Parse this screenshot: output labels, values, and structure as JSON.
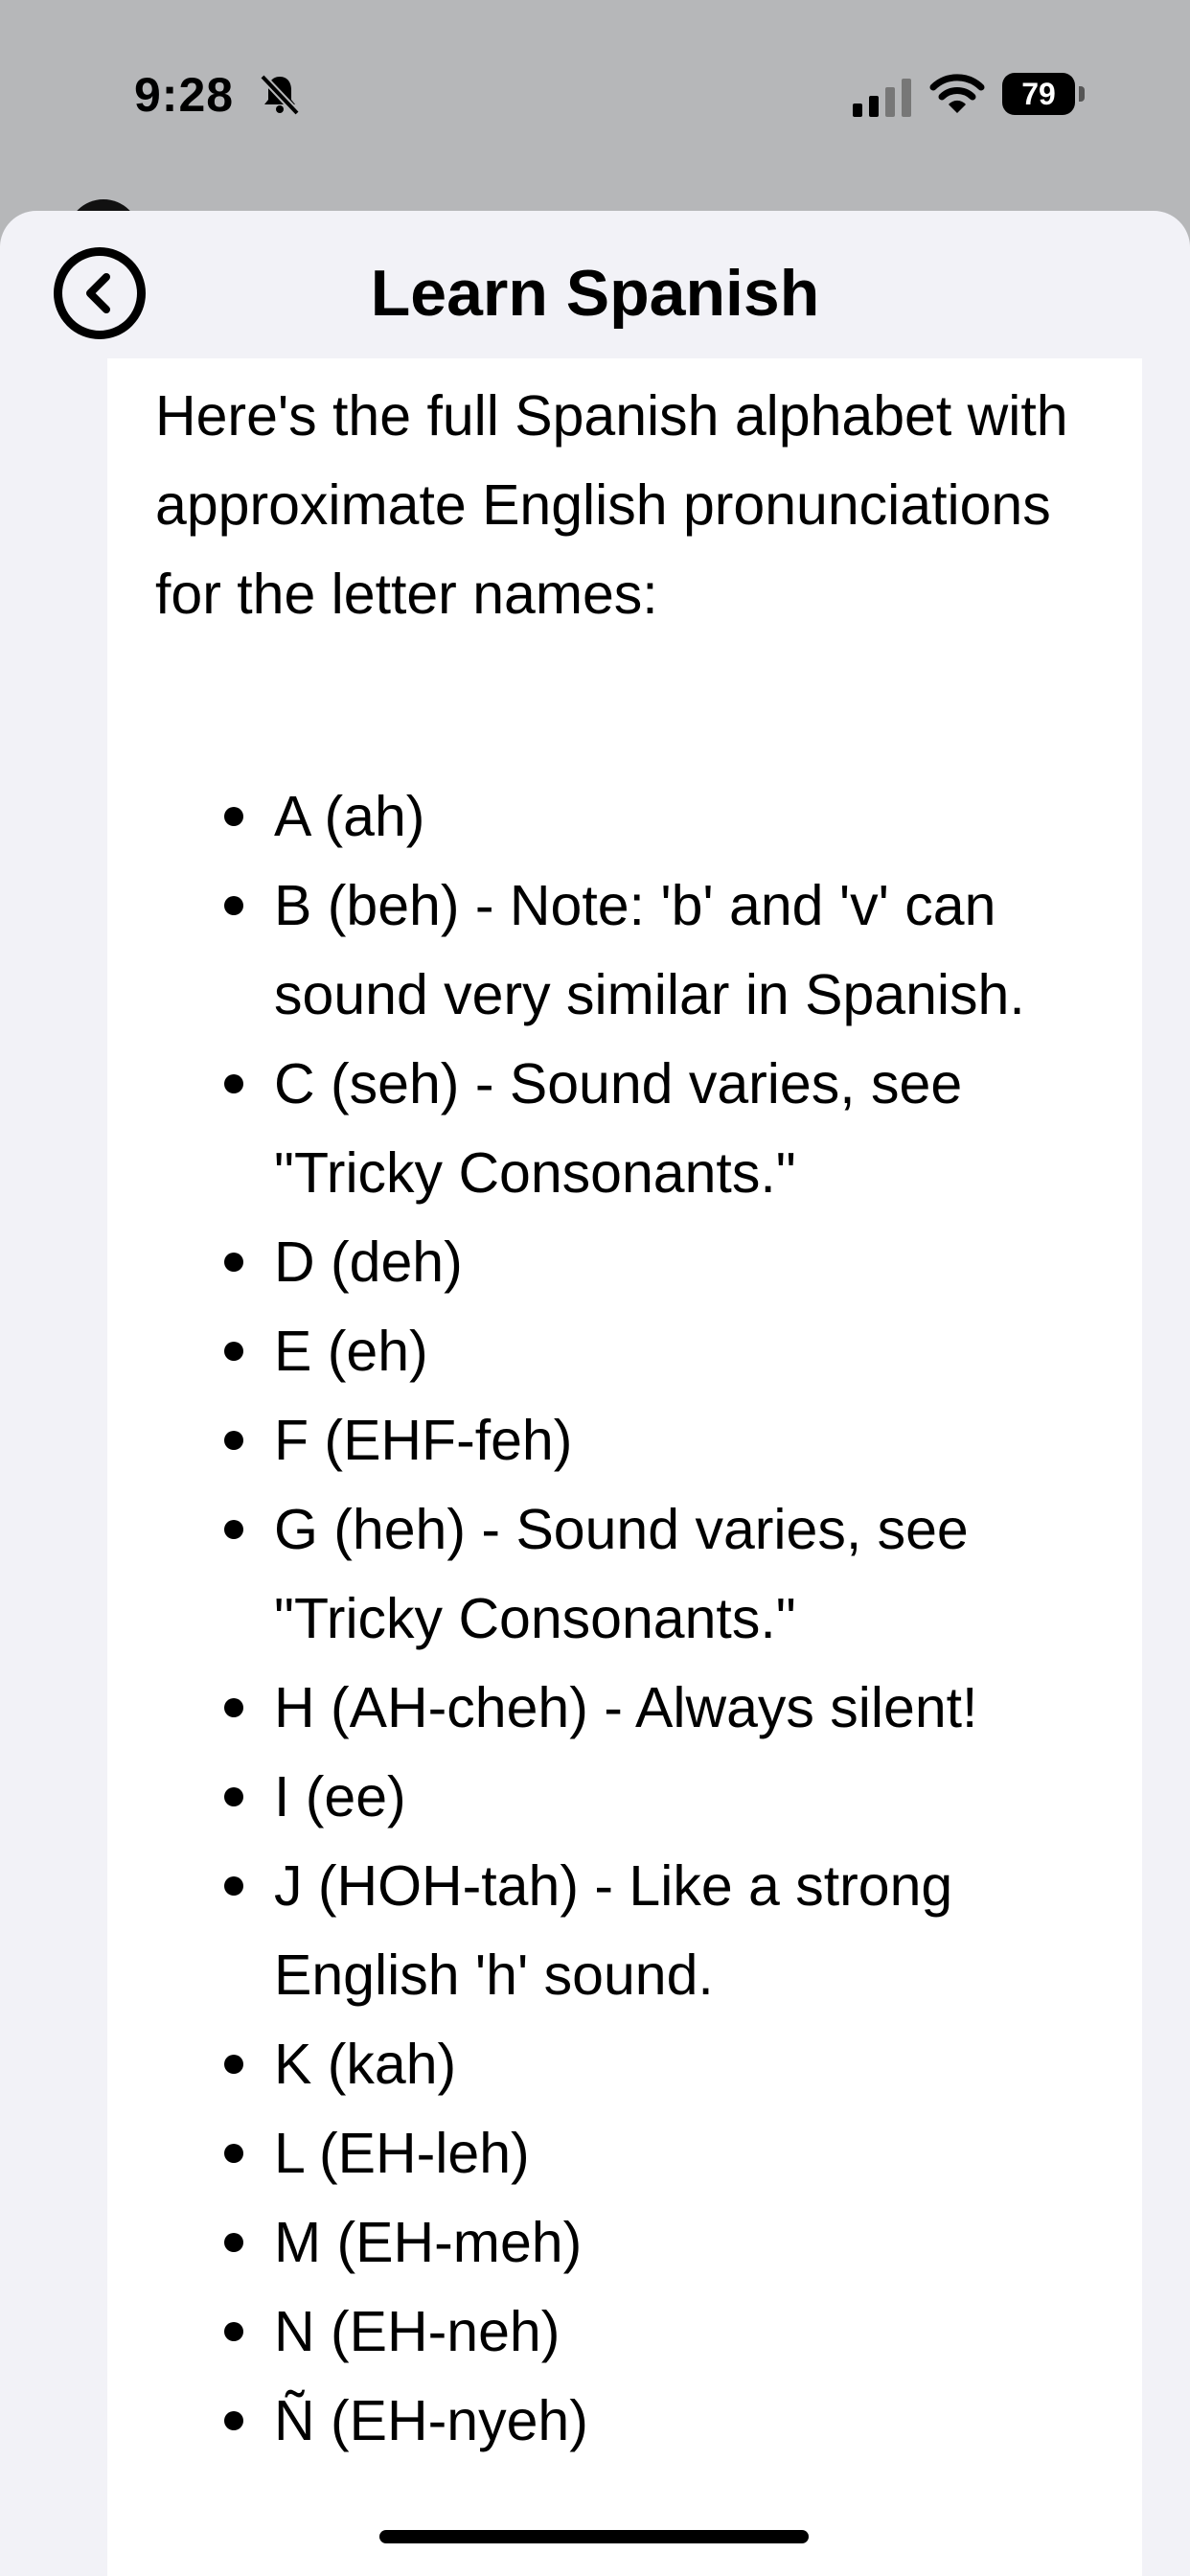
{
  "status_bar": {
    "time": "9:28",
    "battery": "79",
    "icons": [
      "bell-slash-icon",
      "cellular-signal-icon",
      "wifi-icon",
      "battery-icon"
    ]
  },
  "header": {
    "title": "Learn Spanish",
    "back_icon": "chevron-left-circle-icon"
  },
  "content": {
    "intro": "Here's the full Spanish alphabet with approximate English pronunciations for the letter names:",
    "items": [
      "A (ah)",
      "B (beh) - Note: 'b' and 'v' can sound very similar in Spanish.",
      "C (seh) - Sound varies, see \"Tricky Consonants.\"",
      "D (deh)",
      "E (eh)",
      "F (EHF-feh)",
      "G (heh) - Sound varies, see \"Tricky Consonants.\"",
      "H (AH-cheh) - Always silent!",
      "I (ee)",
      "J (HOH-tah) - Like a strong English 'h' sound.",
      "K (kah)",
      "L (EH-leh)",
      "M (EH-meh)",
      "N (EH-neh)",
      "Ñ (EH-nyeh)"
    ]
  },
  "colors": {
    "status_background": "#b6b7b9",
    "sheet_background": "#f2f2f7",
    "card_background": "#ffffff",
    "text": "#000000"
  }
}
